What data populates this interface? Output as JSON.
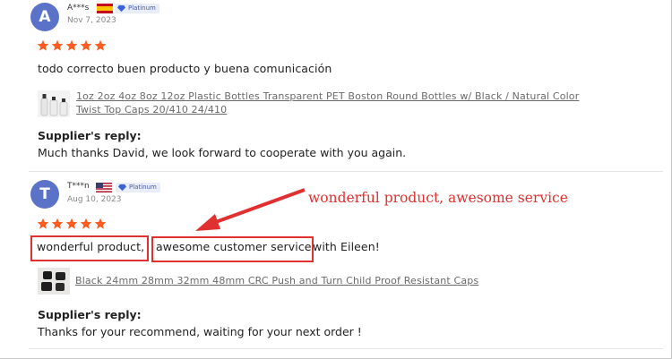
{
  "colors": {
    "accent": "#e0302f",
    "star": "#ff5a1f",
    "avatar": "#5a73c9",
    "badge": "#4a5aa8"
  },
  "reviews": [
    {
      "avatar_letter": "A",
      "reviewer": "A***s",
      "country_flag": "spain-flag",
      "badge": "Platinum",
      "date": "Nov 7, 2023",
      "rating": 5,
      "text": "todo correcto buen producto y buena comunicación",
      "product": {
        "thumb_icon": "bottles-thumbnail",
        "line1": "1oz 2oz 4oz 8oz 12oz Plastic Bottles Transparent PET Boston Round Bottles w/ Black / Natural Color",
        "line2": "Twist Top Caps 20/410 24/410"
      },
      "reply_heading": "Supplier's reply:",
      "reply_text": "Much thanks David, we look forward to cooperate with you again."
    },
    {
      "avatar_letter": "T",
      "reviewer": "T***n",
      "country_flag": "usa-flag",
      "badge": "Platinum",
      "date": "Aug 10, 2023",
      "rating": 5,
      "text_part1": "wonderful product,",
      "text_part2": "awesome customer service",
      "text_part3": "with Eileen!",
      "product": {
        "thumb_icon": "caps-thumbnail",
        "line1": "Black 24mm 28mm 32mm 48mm CRC Push and Turn Child Proof Resistant Caps"
      },
      "reply_heading": "Supplier's reply:",
      "reply_text": "Thanks for your recommend, waiting for your next order !"
    }
  ],
  "annotation": {
    "text": "wonderful product, awesome service"
  }
}
